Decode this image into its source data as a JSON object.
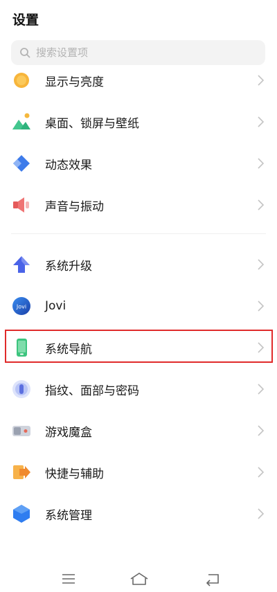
{
  "header": {
    "title": "设置"
  },
  "search": {
    "placeholder": "搜索设置项"
  },
  "items": [
    {
      "label": "显示与亮度"
    },
    {
      "label": "桌面、锁屏与壁纸"
    },
    {
      "label": "动态效果"
    },
    {
      "label": "声音与振动"
    },
    {
      "label": "系统升级"
    },
    {
      "label": "Jovi",
      "icon_text": "Jovi"
    },
    {
      "label": "系统导航"
    },
    {
      "label": "指纹、面部与密码"
    },
    {
      "label": "游戏魔盒"
    },
    {
      "label": "快捷与辅助"
    },
    {
      "label": "系统管理"
    }
  ],
  "colors": {
    "highlight": "#e02a2a",
    "chevron": "#c4c4c4"
  }
}
